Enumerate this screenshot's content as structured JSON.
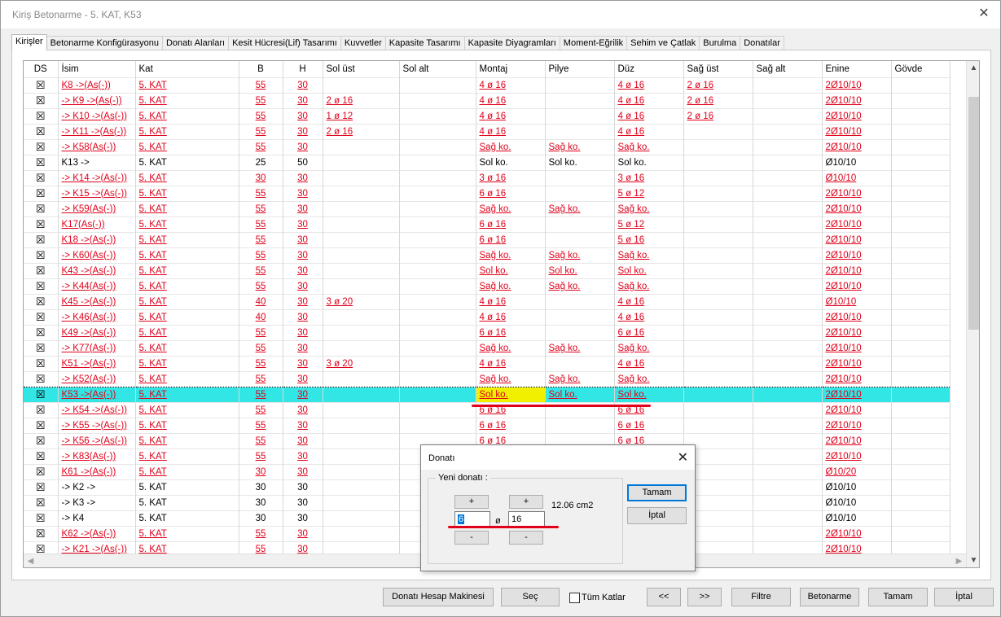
{
  "window": {
    "title": "Kiriş Betonarme - 5. KAT, K53",
    "close": "✕"
  },
  "tabs": [
    "Kirişler",
    "Betonarme Konfigürasyonu",
    "Donatı Alanları",
    "Kesit Hücresi(Lif) Tasarımı",
    "Kuvvetler",
    "Kapasite Tasarımı",
    "Kapasite Diyagramları",
    "Moment-Eğrilik",
    "Sehim ve Çatlak",
    "Burulma",
    "Donatılar"
  ],
  "table": {
    "columns": [
      "DS",
      "İsim",
      "Kat",
      "B",
      "H",
      "Sol üst",
      "Sol alt",
      "Montaj",
      "Pilye",
      "Düz",
      "Sağ üst",
      "Sağ alt",
      "Enine",
      "Gövde"
    ],
    "rows": [
      {
        "ds": "☒",
        "isim": "K8 ->(As(-))",
        "kat": "5. KAT",
        "b": "55",
        "h": "30",
        "solust": "",
        "solalt": "",
        "montaj": "4 ø 16",
        "pilye": "",
        "duz": "4 ø 16",
        "sagust": "2 ø 16",
        "sagalt": "",
        "enine": "2Ø10/10",
        "govde": "",
        "red": true
      },
      {
        "ds": "☒",
        "isim": "-> K9 ->(As(-))",
        "kat": "5. KAT",
        "b": "55",
        "h": "30",
        "solust": "2 ø 16",
        "solalt": "",
        "montaj": "4 ø 16",
        "pilye": "",
        "duz": "4 ø 16",
        "sagust": "2 ø 16",
        "sagalt": "",
        "enine": "2Ø10/10",
        "govde": "",
        "red": true
      },
      {
        "ds": "☒",
        "isim": "-> K10 ->(As(-))",
        "kat": "5. KAT",
        "b": "55",
        "h": "30",
        "solust": "1 ø 12",
        "solalt": "",
        "montaj": "4 ø 16",
        "pilye": "",
        "duz": "4 ø 16",
        "sagust": "2 ø 16",
        "sagalt": "",
        "enine": "2Ø10/10",
        "govde": "",
        "red": true
      },
      {
        "ds": "☒",
        "isim": "-> K11 ->(As(-))",
        "kat": "5. KAT",
        "b": "55",
        "h": "30",
        "solust": "2 ø 16",
        "solalt": "",
        "montaj": "4 ø 16",
        "pilye": "",
        "duz": "4 ø 16",
        "sagust": "",
        "sagalt": "",
        "enine": "2Ø10/10",
        "govde": "",
        "red": true
      },
      {
        "ds": "☒",
        "isim": "-> K58(As(-))",
        "kat": "5. KAT",
        "b": "55",
        "h": "30",
        "solust": "",
        "solalt": "",
        "montaj": "Sağ ko.",
        "pilye": "Sağ ko.",
        "duz": "Sağ ko.",
        "sagust": "",
        "sagalt": "",
        "enine": "2Ø10/10",
        "govde": "",
        "red": true
      },
      {
        "ds": "☒",
        "isim": "K13 ->",
        "kat": "5. KAT",
        "b": "25",
        "h": "50",
        "solust": "",
        "solalt": "",
        "montaj": "Sol ko.",
        "pilye": "Sol ko.",
        "duz": "Sol ko.",
        "sagust": "",
        "sagalt": "",
        "enine": "Ø10/10",
        "govde": "",
        "red": false
      },
      {
        "ds": "☒",
        "isim": "-> K14 ->(As(-))",
        "kat": "5. KAT",
        "b": "30",
        "h": "30",
        "solust": "",
        "solalt": "",
        "montaj": "3 ø 16",
        "pilye": "",
        "duz": "3 ø 16",
        "sagust": "",
        "sagalt": "",
        "enine": "Ø10/10",
        "govde": "",
        "red": true
      },
      {
        "ds": "☒",
        "isim": "-> K15 ->(As(-))",
        "kat": "5. KAT",
        "b": "55",
        "h": "30",
        "solust": "",
        "solalt": "",
        "montaj": "6 ø 16",
        "pilye": "",
        "duz": "5 ø 12",
        "sagust": "",
        "sagalt": "",
        "enine": "2Ø10/10",
        "govde": "",
        "red": true
      },
      {
        "ds": "☒",
        "isim": "-> K59(As(-))",
        "kat": "5. KAT",
        "b": "55",
        "h": "30",
        "solust": "",
        "solalt": "",
        "montaj": "Sağ ko.",
        "pilye": "Sağ ko.",
        "duz": "Sağ ko.",
        "sagust": "",
        "sagalt": "",
        "enine": "2Ø10/10",
        "govde": "",
        "red": true
      },
      {
        "ds": "☒",
        "isim": "K17(As(-))",
        "kat": "5. KAT",
        "b": "55",
        "h": "30",
        "solust": "",
        "solalt": "",
        "montaj": "6 ø 16",
        "pilye": "",
        "duz": "5 ø 12",
        "sagust": "",
        "sagalt": "",
        "enine": "2Ø10/10",
        "govde": "",
        "red": true
      },
      {
        "ds": "☒",
        "isim": "K18 ->(As(-))",
        "kat": "5. KAT",
        "b": "55",
        "h": "30",
        "solust": "",
        "solalt": "",
        "montaj": "6 ø 16",
        "pilye": "",
        "duz": "5 ø 16",
        "sagust": "",
        "sagalt": "",
        "enine": "2Ø10/10",
        "govde": "",
        "red": true
      },
      {
        "ds": "☒",
        "isim": "-> K60(As(-))",
        "kat": "5. KAT",
        "b": "55",
        "h": "30",
        "solust": "",
        "solalt": "",
        "montaj": "Sağ ko.",
        "pilye": "Sağ ko.",
        "duz": "Sağ ko.",
        "sagust": "",
        "sagalt": "",
        "enine": "2Ø10/10",
        "govde": "",
        "red": true
      },
      {
        "ds": "☒",
        "isim": "K43 ->(As(-))",
        "kat": "5. KAT",
        "b": "55",
        "h": "30",
        "solust": "",
        "solalt": "",
        "montaj": "Sol ko.",
        "pilye": "Sol ko.",
        "duz": "Sol ko.",
        "sagust": "",
        "sagalt": "",
        "enine": "2Ø10/10",
        "govde": "",
        "red": true
      },
      {
        "ds": "☒",
        "isim": "-> K44(As(-))",
        "kat": "5. KAT",
        "b": "55",
        "h": "30",
        "solust": "",
        "solalt": "",
        "montaj": "Sağ ko.",
        "pilye": "Sağ ko.",
        "duz": "Sağ ko.",
        "sagust": "",
        "sagalt": "",
        "enine": "2Ø10/10",
        "govde": "",
        "red": true
      },
      {
        "ds": "☒",
        "isim": "K45 ->(As(-))",
        "kat": "5. KAT",
        "b": "40",
        "h": "30",
        "solust": "3 ø 20",
        "solalt": "",
        "montaj": "4 ø 16",
        "pilye": "",
        "duz": "4 ø 16",
        "sagust": "",
        "sagalt": "",
        "enine": "Ø10/10",
        "govde": "",
        "red": true
      },
      {
        "ds": "☒",
        "isim": "-> K46(As(-))",
        "kat": "5. KAT",
        "b": "40",
        "h": "30",
        "solust": "",
        "solalt": "",
        "montaj": "4 ø 16",
        "pilye": "",
        "duz": "4 ø 16",
        "sagust": "",
        "sagalt": "",
        "enine": "2Ø10/10",
        "govde": "",
        "red": true
      },
      {
        "ds": "☒",
        "isim": "K49 ->(As(-))",
        "kat": "5. KAT",
        "b": "55",
        "h": "30",
        "solust": "",
        "solalt": "",
        "montaj": "6 ø 16",
        "pilye": "",
        "duz": "6 ø 16",
        "sagust": "",
        "sagalt": "",
        "enine": "2Ø10/10",
        "govde": "",
        "red": true
      },
      {
        "ds": "☒",
        "isim": "-> K77(As(-))",
        "kat": "5. KAT",
        "b": "55",
        "h": "30",
        "solust": "",
        "solalt": "",
        "montaj": "Sağ ko.",
        "pilye": "Sağ ko.",
        "duz": "Sağ ko.",
        "sagust": "",
        "sagalt": "",
        "enine": "2Ø10/10",
        "govde": "",
        "red": true
      },
      {
        "ds": "☒",
        "isim": "K51 ->(As(-))",
        "kat": "5. KAT",
        "b": "55",
        "h": "30",
        "solust": "3 ø 20",
        "solalt": "",
        "montaj": "4 ø 16",
        "pilye": "",
        "duz": "4 ø 16",
        "sagust": "",
        "sagalt": "",
        "enine": "2Ø10/10",
        "govde": "",
        "red": true
      },
      {
        "ds": "☒",
        "isim": "-> K52(As(-))",
        "kat": "5. KAT",
        "b": "55",
        "h": "30",
        "solust": "",
        "solalt": "",
        "montaj": "Sağ ko.",
        "pilye": "Sağ ko.",
        "duz": "Sağ ko.",
        "sagust": "",
        "sagalt": "",
        "enine": "2Ø10/10",
        "govde": "",
        "red": true
      },
      {
        "ds": "☒",
        "isim": "K53 ->(As(-))",
        "kat": "5. KAT",
        "b": "55",
        "h": "30",
        "solust": "",
        "solalt": "",
        "montaj": "Sol ko.",
        "pilye": "Sol ko.",
        "duz": "Sol ko.",
        "sagust": "",
        "sagalt": "",
        "enine": "2Ø10/10",
        "govde": "",
        "red": true,
        "selected": true
      },
      {
        "ds": "☒",
        "isim": "-> K54 ->(As(-))",
        "kat": "5. KAT",
        "b": "55",
        "h": "30",
        "solust": "",
        "solalt": "",
        "montaj": "6 ø 16",
        "pilye": "",
        "duz": "6 ø 16",
        "sagust": "",
        "sagalt": "",
        "enine": "2Ø10/10",
        "govde": "",
        "red": true
      },
      {
        "ds": "☒",
        "isim": "-> K55 ->(As(-))",
        "kat": "5. KAT",
        "b": "55",
        "h": "30",
        "solust": "",
        "solalt": "",
        "montaj": "6 ø 16",
        "pilye": "",
        "duz": "6 ø 16",
        "sagust": "",
        "sagalt": "",
        "enine": "2Ø10/10",
        "govde": "",
        "red": true
      },
      {
        "ds": "☒",
        "isim": "-> K56 ->(As(-))",
        "kat": "5. KAT",
        "b": "55",
        "h": "30",
        "solust": "",
        "solalt": "",
        "montaj": "6 ø 16",
        "pilye": "",
        "duz": "6 ø 16",
        "sagust": "",
        "sagalt": "",
        "enine": "2Ø10/10",
        "govde": "",
        "red": true
      },
      {
        "ds": "☒",
        "isim": "-> K83(As(-))",
        "kat": "5. KAT",
        "b": "55",
        "h": "30",
        "solust": "",
        "solalt": "",
        "montaj": "",
        "pilye": "",
        "duz": "",
        "sagust": "",
        "sagalt": "",
        "enine": "2Ø10/10",
        "govde": "",
        "red": true
      },
      {
        "ds": "☒",
        "isim": "K61 ->(As(-))",
        "kat": "5. KAT",
        "b": "30",
        "h": "30",
        "solust": "",
        "solalt": "",
        "montaj": "",
        "pilye": "",
        "duz": "",
        "sagust": "",
        "sagalt": "",
        "enine": "Ø10/20",
        "govde": "",
        "red": true
      },
      {
        "ds": "☒",
        "isim": "-> K2 ->",
        "kat": "5. KAT",
        "b": "30",
        "h": "30",
        "solust": "",
        "solalt": "",
        "montaj": "",
        "pilye": "",
        "duz": "",
        "sagust": "",
        "sagalt": "",
        "enine": "Ø10/10",
        "govde": "",
        "red": false
      },
      {
        "ds": "☒",
        "isim": "-> K3 ->",
        "kat": "5. KAT",
        "b": "30",
        "h": "30",
        "solust": "",
        "solalt": "",
        "montaj": "",
        "pilye": "",
        "duz": "",
        "sagust": "",
        "sagalt": "",
        "enine": "Ø10/10",
        "govde": "",
        "red": false
      },
      {
        "ds": "☒",
        "isim": "-> K4",
        "kat": "5. KAT",
        "b": "30",
        "h": "30",
        "solust": "",
        "solalt": "",
        "montaj": "",
        "pilye": "",
        "duz": "",
        "sagust": "",
        "sagalt": "",
        "enine": "Ø10/10",
        "govde": "",
        "red": false
      },
      {
        "ds": "☒",
        "isim": "K62 ->(As(-))",
        "kat": "5. KAT",
        "b": "55",
        "h": "30",
        "solust": "",
        "solalt": "",
        "montaj": "",
        "pilye": "",
        "duz": "",
        "sagust": "",
        "sagalt": "",
        "enine": "2Ø10/10",
        "govde": "",
        "red": true
      },
      {
        "ds": "☒",
        "isim": "-> K21 ->(As(-))",
        "kat": "5. KAT",
        "b": "55",
        "h": "30",
        "solust": "",
        "solalt": "",
        "montaj": "",
        "pilye": "",
        "duz": "",
        "sagust": "",
        "sagalt": "",
        "enine": "2Ø10/10",
        "govde": "",
        "red": true
      }
    ]
  },
  "scroll": {
    "up": "▲",
    "down": "▼",
    "left": "◀",
    "right": "▶"
  },
  "bottom_buttons": {
    "calc": "Donatı Hesap Makinesi",
    "select": "Seç",
    "all_floors": "Tüm Katlar",
    "prev": "<<",
    "next": ">>",
    "filter": "Filtre",
    "concrete": "Betonarme",
    "ok": "Tamam",
    "cancel": "İptal"
  },
  "dialog": {
    "title": "Donatı",
    "close": "✕",
    "group_label": "Yeni donatı :",
    "plus": "+",
    "minus": "-",
    "count": "6",
    "diameter": "16",
    "phi": "ø",
    "area": "12.06 cm2",
    "ok": "Tamam",
    "cancel": "İptal"
  },
  "colors": {
    "link_red": "#e0001a",
    "selected_row": "#33e6e6",
    "highlight_cell": "#f0f000",
    "annotation_red": "#e0001a"
  }
}
